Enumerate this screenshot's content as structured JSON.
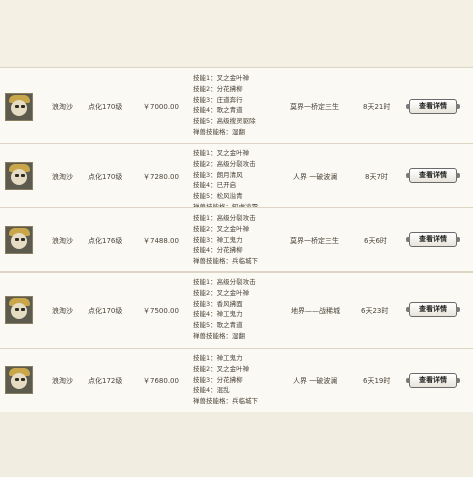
{
  "listings": [
    {
      "server": "浪淘沙",
      "level": "点化170级",
      "price": "￥7000.00",
      "skills": [
        "技能1：叉之金叶禅",
        "技能2：分花拂柳",
        "技能3：庄道奔行",
        "技能4：歌之青道",
        "技能5：高级搜灵驱除",
        "禅兽技能格：湿翻"
      ],
      "location": "莫界一桥定三生",
      "time_left": "8天21时",
      "action": "查看详情"
    },
    {
      "server": "浪淘沙",
      "level": "点化170级",
      "price": "￥7280.00",
      "skills": [
        "技能1：叉之金叶禅",
        "技能2：高级分裂攻击",
        "技能3：朗月清风",
        "技能4：已开启",
        "技能5：松风溢青",
        "禅兽技能格：知虎凌霜"
      ],
      "location": "人界 一破波澜",
      "time_left": "8天7时",
      "action": "查看详情"
    },
    {
      "server": "浪淘沙",
      "level": "点化176级",
      "price": "￥7488.00",
      "skills": [
        "技能1：高级分裂攻击",
        "技能2：叉之金叶禅",
        "技能3：禅工鬼力",
        "技能4：分花拂柳",
        "禅兽技能格：兵临城下"
      ],
      "location": "莫界一桥定三生",
      "time_left": "6天6时",
      "action": "查看详情"
    },
    {
      "server": "浪淘沙",
      "level": "点化170级",
      "price": "￥7500.00",
      "skills": [
        "技能1：高级分裂攻击",
        "技能2：叉之金叶禅",
        "技能3：香风拂面",
        "技能4：禅工鬼力",
        "技能5：歌之青道",
        "禅兽技能格：湿翻"
      ],
      "location": "地界——战稀城",
      "time_left": "6天23时",
      "action": "查看详情"
    },
    {
      "server": "浪淘沙",
      "level": "点化172级",
      "price": "￥7680.00",
      "skills": [
        "技能1：禅工鬼力",
        "技能2：叉之金叶禅",
        "技能3：分花拂柳",
        "技能4：混乱",
        "禅兽技能格：兵临城下"
      ],
      "location": "人界 一破波澜",
      "time_left": "6天19时",
      "action": "查看详情"
    }
  ]
}
